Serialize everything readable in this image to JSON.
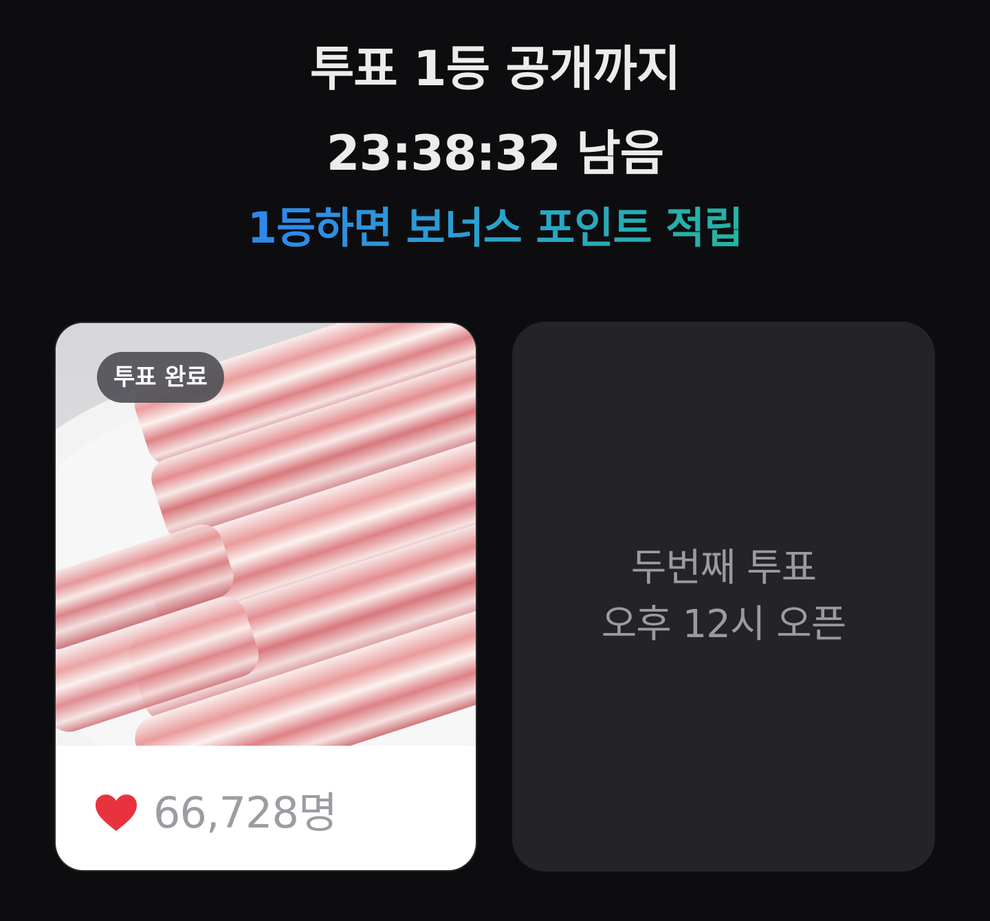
{
  "header": {
    "line1": "투표 1등 공개까지",
    "line2": "23:38:32 남음",
    "bonus": "1등하면 보너스 포인트 적립"
  },
  "cards": {
    "voted": {
      "badge": "투표 완료",
      "count": "66,728명",
      "icon": "heart-icon"
    },
    "locked": {
      "line1": "두번째 투표",
      "line2": "오후 12시 오픈"
    }
  },
  "colors": {
    "background": "#0d0d0f",
    "heading": "#ececec",
    "bonus_gradient_start": "#2f86ee",
    "bonus_gradient_end": "#24b3a0",
    "heart": "#e8333f",
    "locked_card": "#232328",
    "muted_text": "#9a9aa0"
  }
}
